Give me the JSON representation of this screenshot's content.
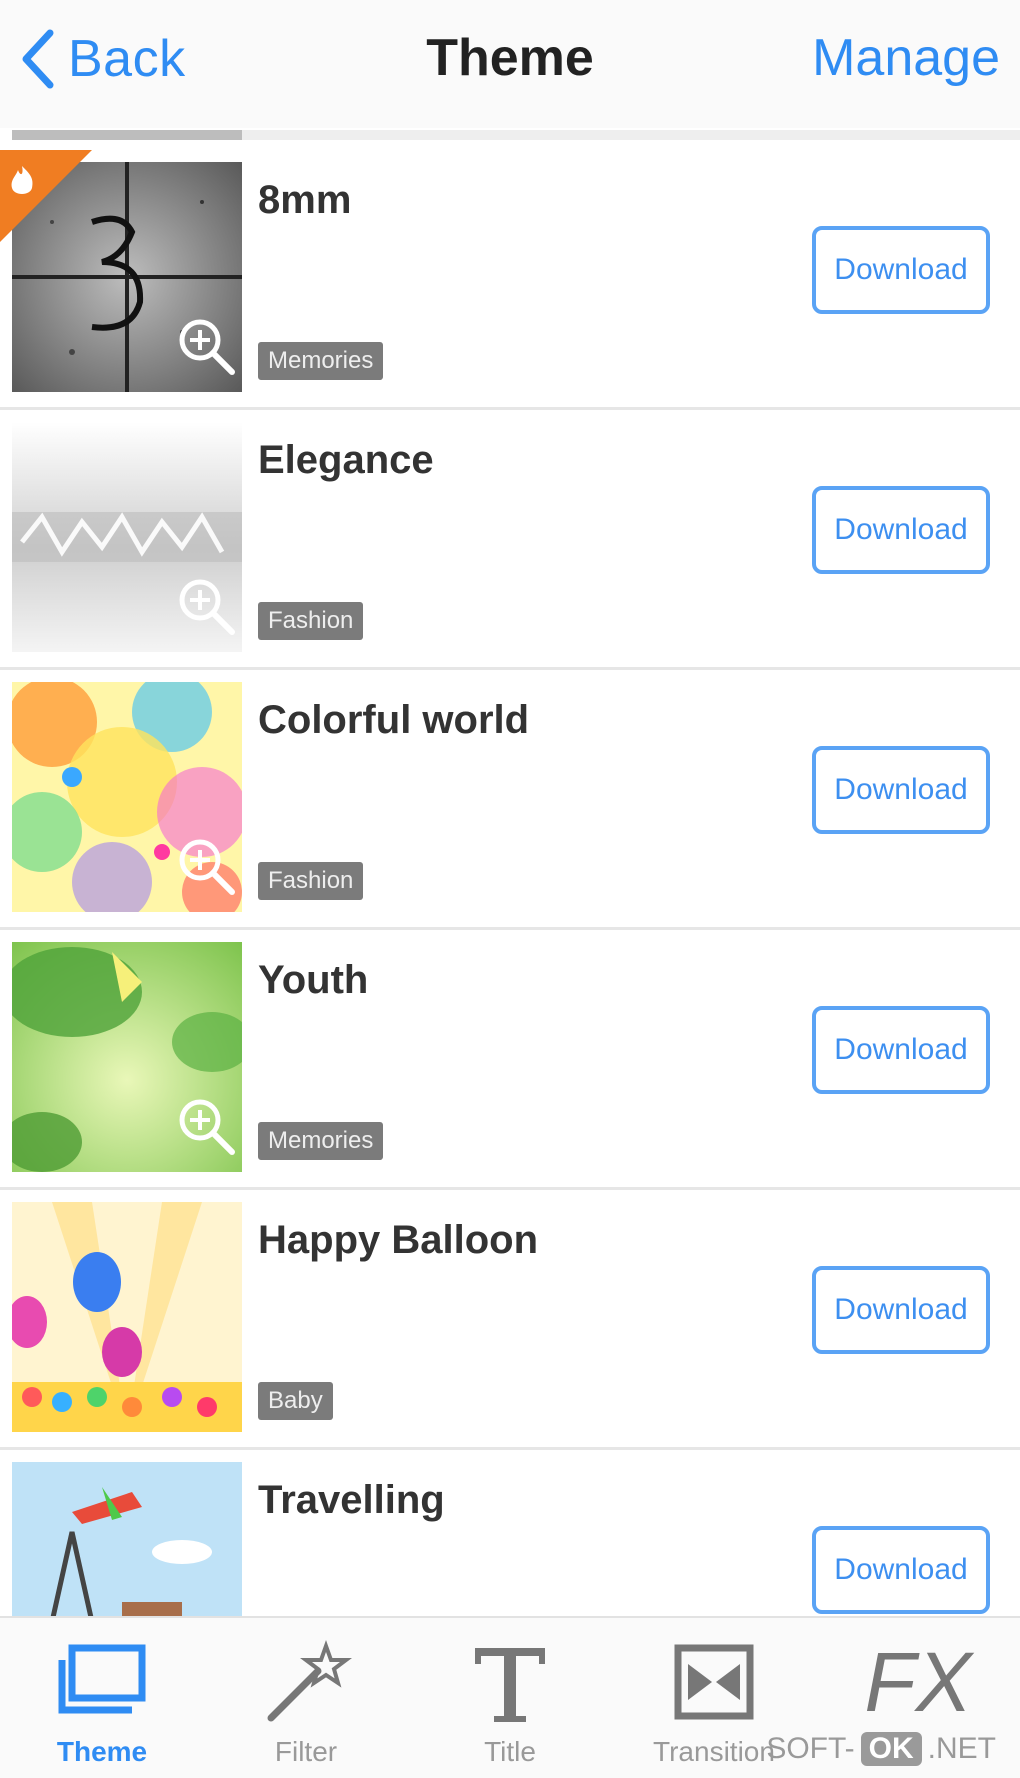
{
  "navbar": {
    "back_label": "Back",
    "title": "Theme",
    "manage_label": "Manage"
  },
  "colors": {
    "accent": "#2f8cf3",
    "tag_bg": "#7b7b7b",
    "hot_badge": "#f07d22"
  },
  "themes": [
    {
      "name": "8mm",
      "tag": "Memories",
      "download_label": "Download"
    },
    {
      "name": "Elegance",
      "tag": "Fashion",
      "download_label": "Download"
    },
    {
      "name": "Colorful world",
      "tag": "Fashion",
      "download_label": "Download"
    },
    {
      "name": "Youth",
      "tag": "Memories",
      "download_label": "Download"
    },
    {
      "name": "Happy Balloon",
      "tag": "Baby",
      "download_label": "Download"
    },
    {
      "name": "Travelling",
      "tag": "",
      "download_label": "Download"
    }
  ],
  "tabbar": {
    "tabs": [
      {
        "label": "Theme",
        "icon": "theme-icon",
        "active": true
      },
      {
        "label": "Filter",
        "icon": "magic-wand-icon",
        "active": false
      },
      {
        "label": "Title",
        "icon": "text-icon",
        "active": false
      },
      {
        "label": "Transition",
        "icon": "transition-icon",
        "active": false
      },
      {
        "label": "",
        "icon": "fx-icon",
        "active": false
      }
    ],
    "fx_text": "FX"
  },
  "watermark": {
    "left": "SOFT-",
    "ok": "OK",
    "right": ".NET"
  }
}
